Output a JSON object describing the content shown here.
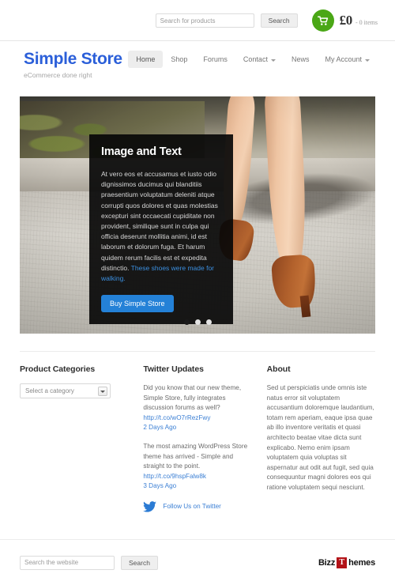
{
  "topbar": {
    "product_search": {
      "placeholder": "Search for products",
      "value": "",
      "button_label": "Search"
    },
    "cart": {
      "icon": "shopping-cart-icon",
      "total": "£0",
      "items_text": "- 0 items",
      "accent_color": "#4aa716"
    }
  },
  "header": {
    "brand_title": "Simple Store",
    "brand_tagline": "eCommerce done right",
    "brand_color": "#2b5fd9",
    "nav": [
      {
        "label": "Home",
        "active": true,
        "caret": false
      },
      {
        "label": "Shop",
        "active": false,
        "caret": false
      },
      {
        "label": "Forums",
        "active": false,
        "caret": false
      },
      {
        "label": "Contact",
        "active": false,
        "caret": true
      },
      {
        "label": "News",
        "active": false,
        "caret": false
      },
      {
        "label": "My Account",
        "active": false,
        "caret": true
      }
    ]
  },
  "slider": {
    "caption": {
      "title": "Image and Text",
      "body": "At vero eos et accusamus et iusto odio dignissimos ducimus qui blanditiis praesentium voluptatum deleniti atque corrupti quos dolores et quas molestias excepturi sint occaecati cupiditate non provident, similique sunt in culpa qui officia deserunt mollitia animi, id est laborum et dolorum fuga. Et harum quidem rerum facilis est et expedita distinctio. ",
      "link_text": "These shoes were made for walking.",
      "button_label": "Buy Simple Store",
      "button_color": "#2481d7"
    },
    "dots": [
      {
        "active": true
      },
      {
        "active": false
      },
      {
        "active": false
      }
    ]
  },
  "columns": {
    "product_categories": {
      "heading": "Product Categories",
      "select_value": "Select a category"
    },
    "twitter": {
      "heading": "Twitter Updates",
      "tweets": [
        {
          "text": "Did you know that our new theme, Simple Store, fully integrates discussion forums as well?",
          "link": "http://t.co/wO7rRezFwy",
          "time": "2 Days Ago"
        },
        {
          "text": "The most amazing WordPress Store theme has arrived - Simple and straight to the point.",
          "link": "http://t.co/9hspFalw8k",
          "time": "3 Days Ago"
        }
      ],
      "follow_icon": "twitter-bird-icon",
      "follow_label": "Follow Us on Twitter"
    },
    "about": {
      "heading": "About",
      "text": "Sed ut perspiciatis unde omnis iste natus error sit voluptatem accusantium doloremque laudantium, totam rem aperiam, eaque ipsa quae ab illo inventore veritatis et quasi architecto beatae vitae dicta sunt explicabo. Nemo enim ipsam voluptatem quia voluptas sit aspernatur aut odit aut fugit, sed quia consequuntur magni dolores eos qui ratione voluptatem sequi nesciunt."
    }
  },
  "footer": {
    "search": {
      "placeholder": "Search the website",
      "value": "",
      "button_label": "Search"
    },
    "credit": {
      "part1": "Bizz",
      "mark": "T",
      "part2": "hemes",
      "mark_color": "#b31217"
    }
  }
}
